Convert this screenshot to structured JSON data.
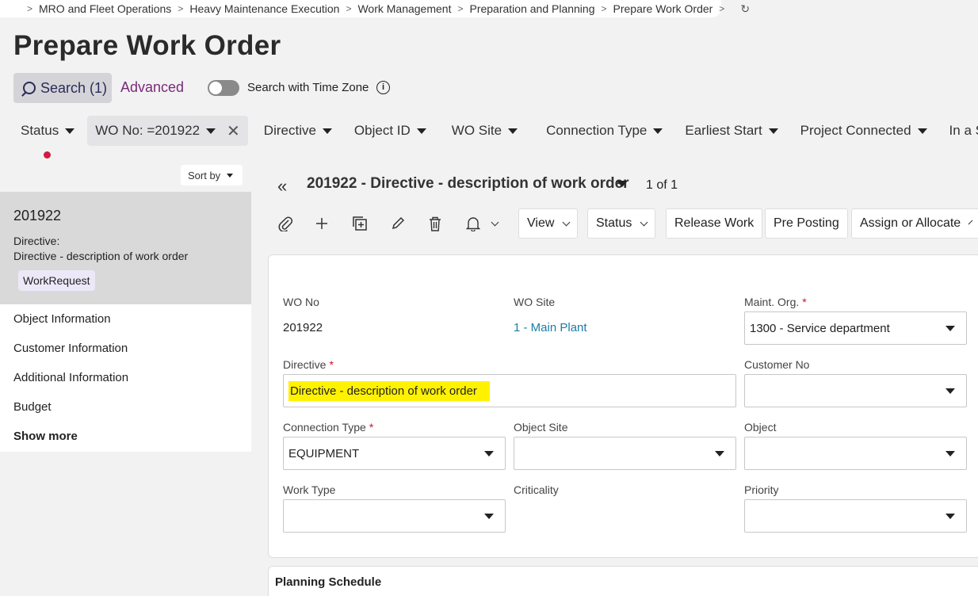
{
  "breadcrumb": [
    "MRO and Fleet Operations",
    "Heavy Maintenance Execution",
    "Work Management",
    "Preparation and Planning",
    "Prepare Work Order"
  ],
  "page_title": "Prepare Work Order",
  "search": {
    "label": "Search (1)",
    "advanced": "Advanced",
    "timezone_label": "Search with Time Zone"
  },
  "filters": [
    "Status",
    "Directive",
    "Object ID",
    "WO Site",
    "Connection Type",
    "Earliest Start",
    "Project Connected",
    "In a Stru"
  ],
  "active_filter": "WO No: =201922",
  "sort_by": "Sort by",
  "record_card": {
    "number": "201922",
    "directive_label": "Directive:",
    "directive": "Directive - description of work order",
    "badge": "WorkRequest"
  },
  "side_nav": [
    "Object Information",
    "Customer Information",
    "Additional Information",
    "Budget",
    "Show more"
  ],
  "record_header": {
    "title": "201922 - Directive - description of work order",
    "count": "1 of 1"
  },
  "toolbar": {
    "view": "View",
    "status": "Status",
    "release_work": "Release Work",
    "pre_posting": "Pre Posting",
    "assign": "Assign or Allocate"
  },
  "form": {
    "wo_no_label": "WO No",
    "wo_no": "201922",
    "wo_site_label": "WO Site",
    "wo_site": "1 - Main Plant",
    "maint_org_label": "Maint. Org.",
    "maint_org": "1300 - Service department",
    "directive_label": "Directive",
    "directive": "Directive - description of work order",
    "customer_no_label": "Customer No",
    "customer_no": "",
    "connection_type_label": "Connection Type",
    "connection_type": "EQUIPMENT",
    "object_site_label": "Object Site",
    "object_site": "",
    "object_label": "Object",
    "object": "",
    "work_type_label": "Work Type",
    "work_type": "",
    "criticality_label": "Criticality",
    "priority_label": "Priority",
    "priority": "",
    "required_mark": "*"
  },
  "planning_title": "Planning Schedule",
  "colors": {
    "highlight": "#fff200",
    "link": "#1a7ca8",
    "required": "#c8102e",
    "advanced": "#7a2a7a"
  }
}
